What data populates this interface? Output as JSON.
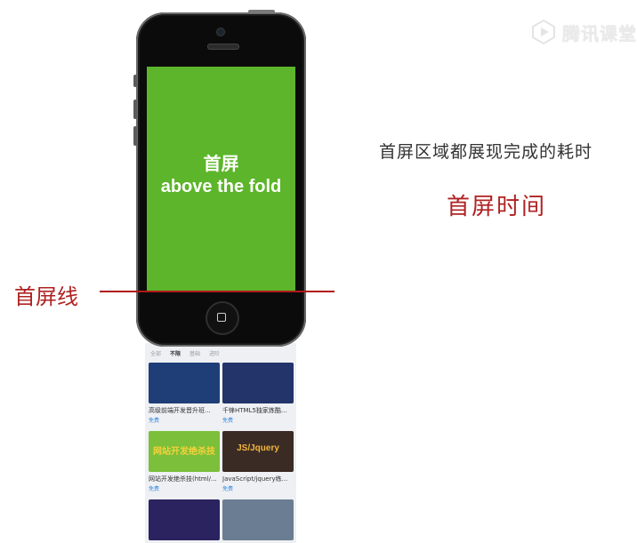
{
  "watermark": {
    "label": "腾讯课堂",
    "icon": "play-logo-icon"
  },
  "phone": {
    "screen_line1": "首屏",
    "screen_line2": "above the fold",
    "screen_color": "#5cb52a",
    "below": {
      "tabs": [
        "全部",
        "不限",
        "基础",
        "进阶"
      ],
      "active_tab": "不限",
      "courses": [
        {
          "title": "高级前端开发晋升班...",
          "price": "免费",
          "thumb_color": "#1f3e78",
          "thumb_text": ""
        },
        {
          "title": "千锋HTML5独家炼酷...",
          "price": "免费",
          "thumb_color": "#23346b",
          "thumb_text": ""
        },
        {
          "title": "网站开发绝杀技(html/...",
          "price": "免费",
          "thumb_color": "#7bbf3a",
          "thumb_text": "网站开发绝杀技"
        },
        {
          "title": "JavaScript/jquery练...",
          "price": "免费",
          "thumb_color": "#3a2c25",
          "thumb_text": "JS/Jquery"
        },
        {
          "title": "",
          "price": "",
          "thumb_color": "#2a2360",
          "thumb_text": ""
        },
        {
          "title": "",
          "price": "",
          "thumb_color": "#6b7d92",
          "thumb_text": ""
        }
      ]
    }
  },
  "annotations": {
    "fold_label": "首屏线",
    "description": "首屏区域都展现完成的耗时",
    "description_title": "首屏时间",
    "accent_color": "#b02222"
  }
}
